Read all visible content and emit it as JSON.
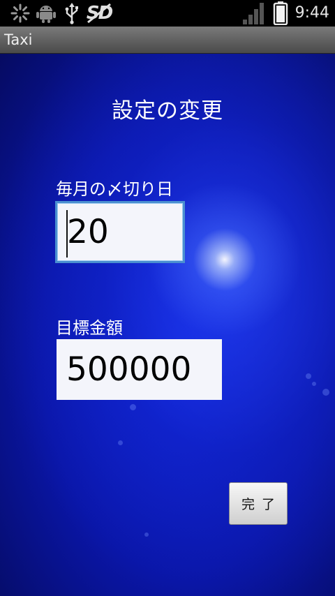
{
  "status_bar": {
    "time": "9:44",
    "sd_label": "SD",
    "icons": [
      "loading-icon",
      "android-icon",
      "usb-icon",
      "sd-card-icon",
      "signal-icon",
      "battery-icon"
    ]
  },
  "title_bar": {
    "app_title": "Taxi"
  },
  "main": {
    "heading": "設定の変更",
    "closing_day": {
      "label": "毎月の〆切り日",
      "value": "20"
    },
    "target_amount": {
      "label": "目標金額",
      "value": "500000"
    },
    "done_button_label": "完了"
  },
  "colors": {
    "status_bar_bg": "#000000",
    "title_bar_bg": "#5a5a5a",
    "background_blue": "#0a16a8",
    "focus_border": "#4a8fd0"
  }
}
